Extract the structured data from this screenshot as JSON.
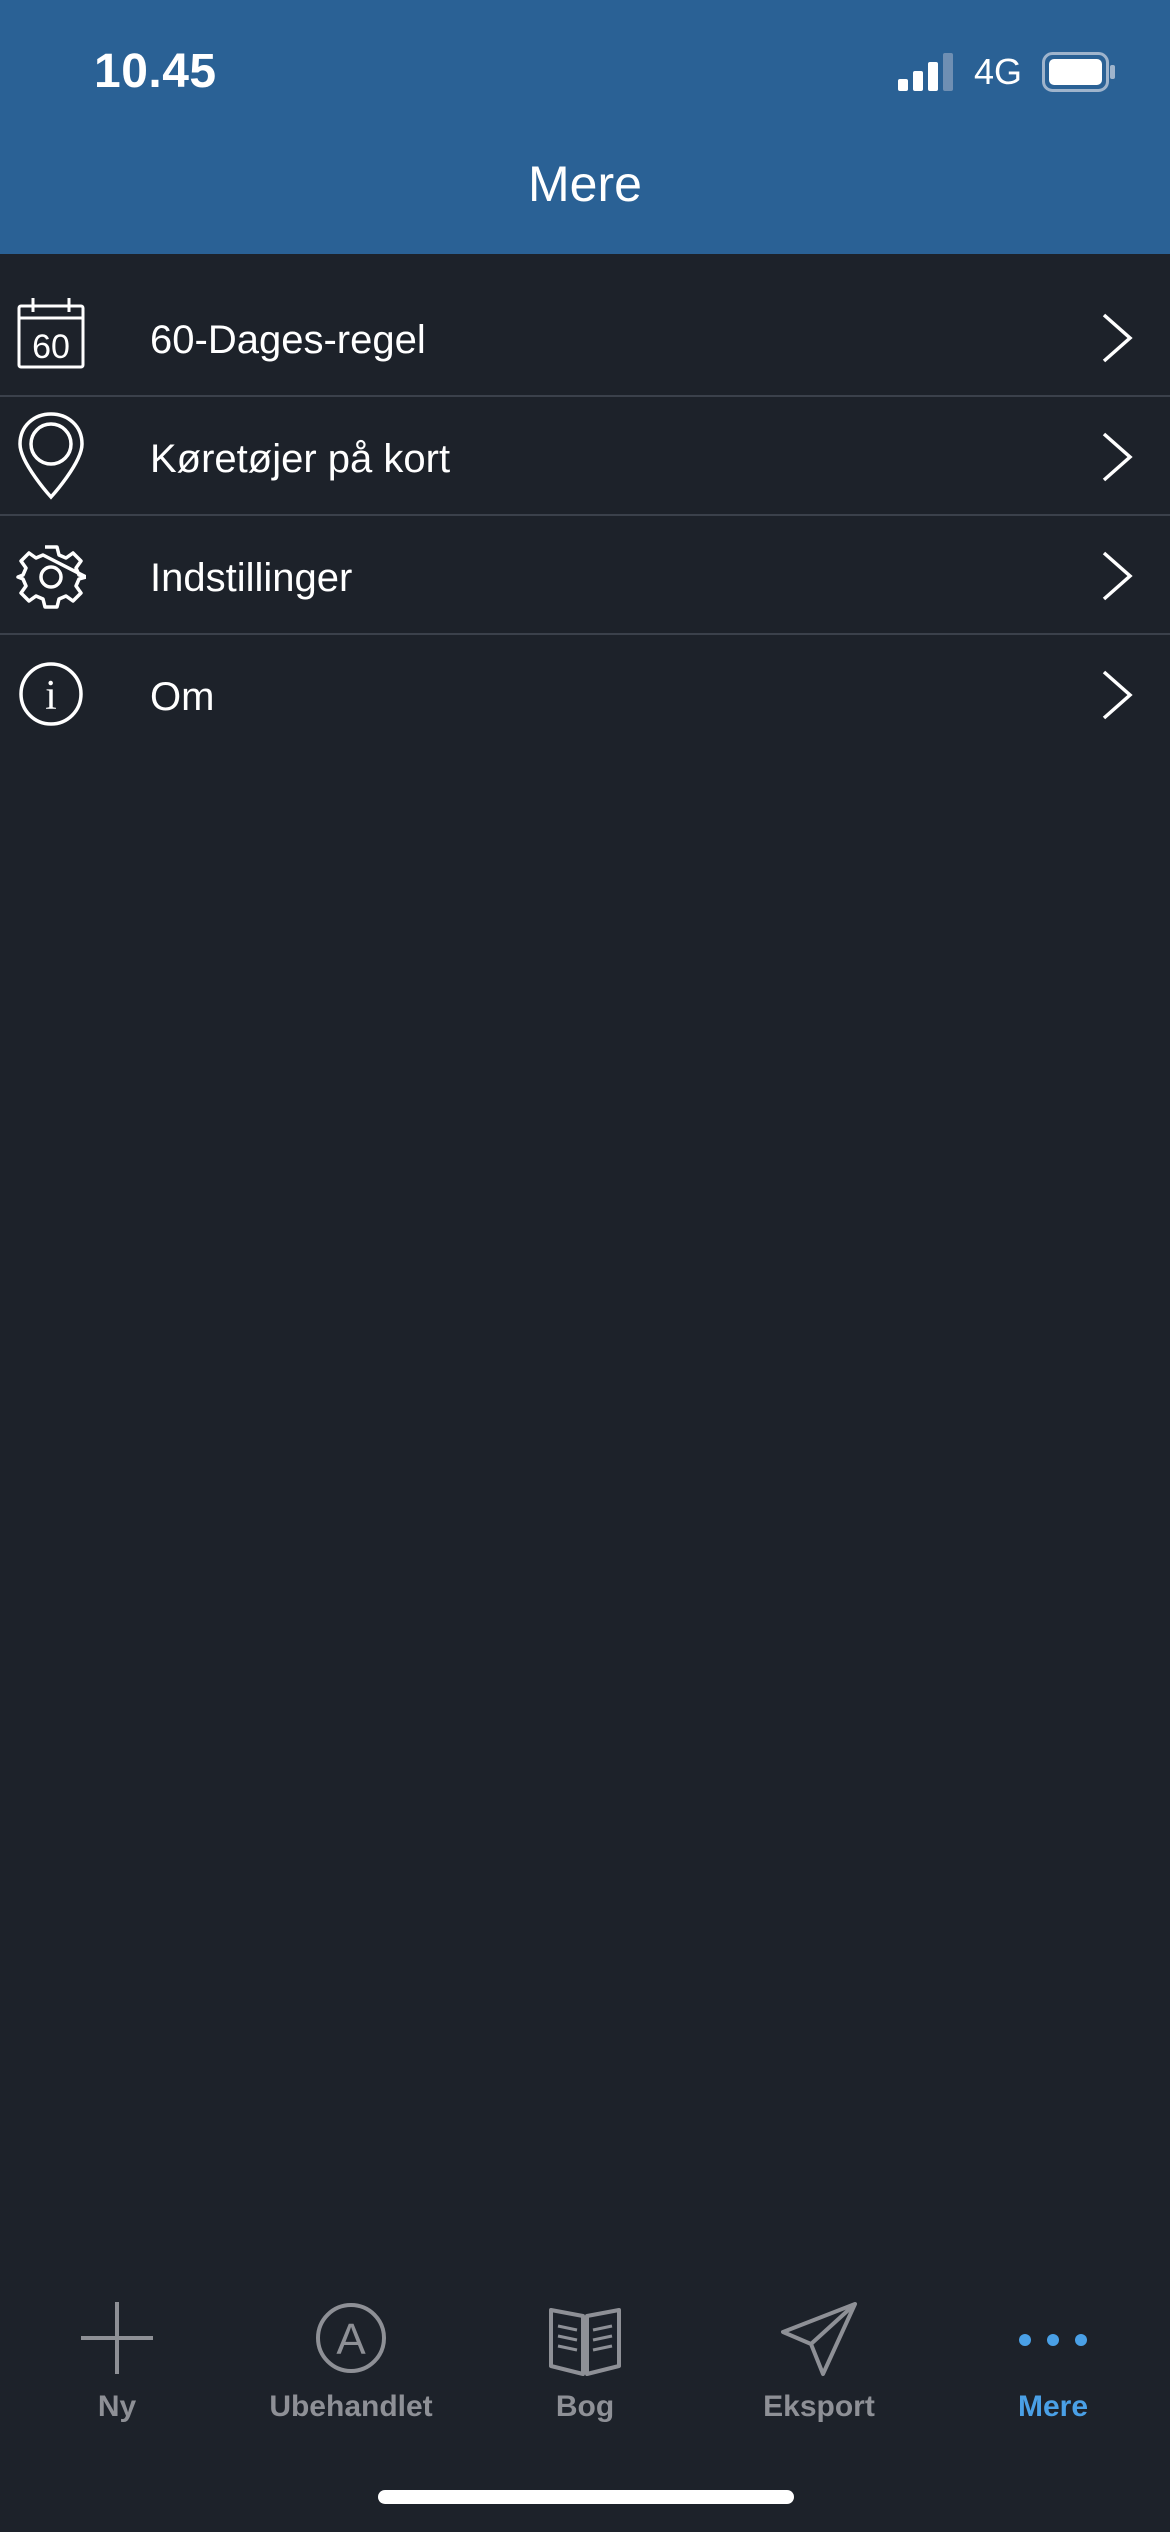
{
  "status_bar": {
    "time": "10.45",
    "network": "4G",
    "icons": [
      "signal-icon",
      "battery-icon"
    ]
  },
  "nav": {
    "title": "Mere"
  },
  "menu": {
    "items": [
      {
        "icon": "calendar-60-icon",
        "icon_text": "60",
        "label": "60-Dages-regel"
      },
      {
        "icon": "map-pin-icon",
        "label": "Køretøjer på kort"
      },
      {
        "icon": "gear-icon",
        "label": "Indstillinger"
      },
      {
        "icon": "info-icon",
        "icon_text": "i",
        "label": "Om"
      }
    ]
  },
  "tabbar": {
    "tabs": [
      {
        "icon": "plus-icon",
        "label": "Ny",
        "active": false
      },
      {
        "icon": "circle-a-icon",
        "icon_text": "A",
        "label": "Ubehandlet",
        "active": false
      },
      {
        "icon": "book-icon",
        "label": "Bog",
        "active": false
      },
      {
        "icon": "paper-plane-icon",
        "label": "Eksport",
        "active": false
      },
      {
        "icon": "more-dots-icon",
        "label": "Mere",
        "active": true
      }
    ]
  },
  "colors": {
    "header_bg": "#2a6195",
    "body_bg": "#1d222a",
    "divider": "#3b414b",
    "tab_inactive": "#8e9096",
    "tab_active": "#4aa0e6"
  }
}
